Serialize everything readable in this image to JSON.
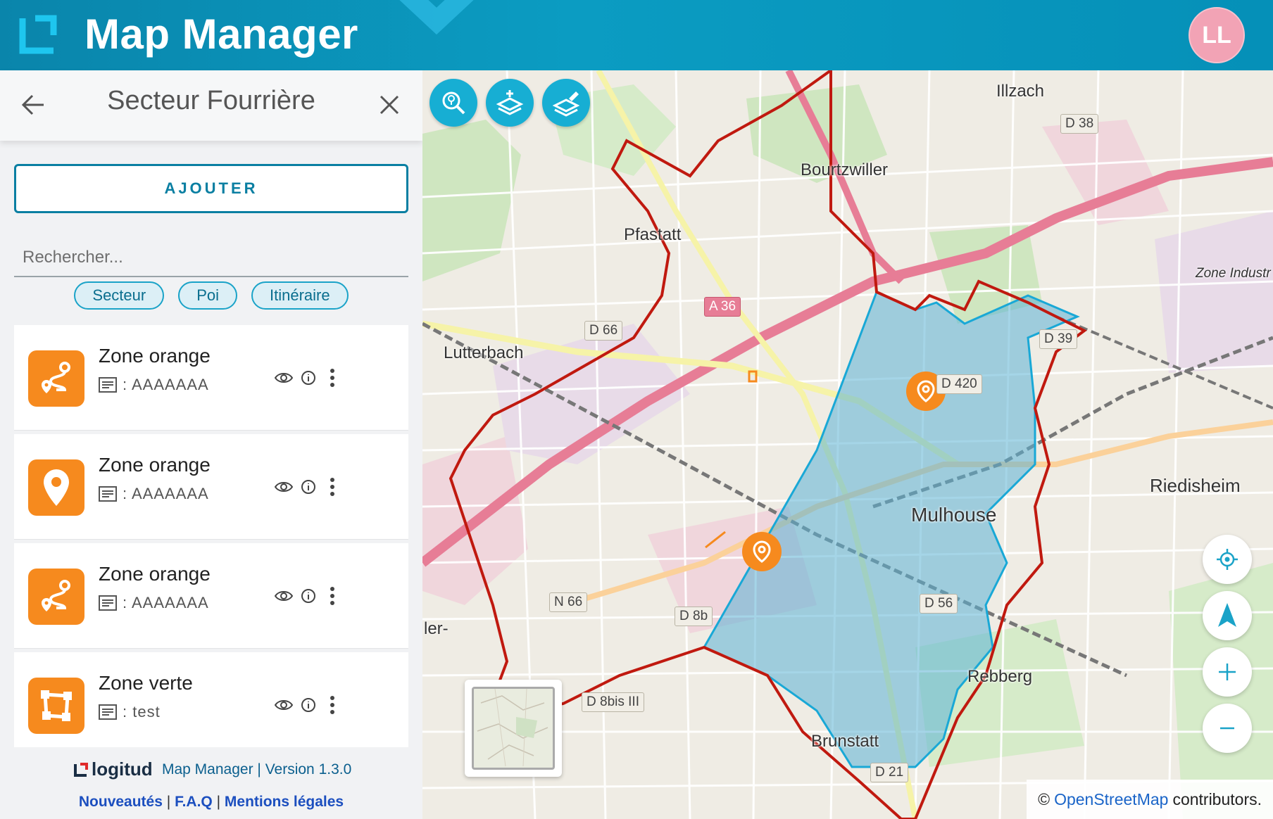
{
  "header": {
    "app_title": "Map Manager",
    "avatar_initials": "LL"
  },
  "sidebar": {
    "title": "Secteur Fourrière",
    "add_label": "AJOUTER",
    "search_placeholder": "Rechercher...",
    "chips": [
      "Secteur",
      "Poi",
      "Itinéraire"
    ],
    "items": [
      {
        "name": "Zone orange",
        "desc": ": AAAAAAA",
        "icon": "route-icon"
      },
      {
        "name": "Zone orange",
        "desc": ": AAAAAAA",
        "icon": "location-pin-icon"
      },
      {
        "name": "Zone orange",
        "desc": ": AAAAAAA",
        "icon": "route-icon"
      },
      {
        "name": "Zone verte",
        "desc": ": test",
        "icon": "polygon-icon"
      }
    ]
  },
  "footer": {
    "brand": "logitud",
    "version_text": "Map Manager | Version 1.3.0",
    "link_news": "Nouveautés",
    "link_faq": "F.A.Q",
    "link_legal": "Mentions légales",
    "sep": "|"
  },
  "map": {
    "places": {
      "illzach": "Illzach",
      "bourtzwiller": "Bourtzwiller",
      "pfastatt": "Pfastatt",
      "lutterbach": "Lutterbach",
      "mulhouse": "Mulhouse",
      "riedisheim": "Riedisheim",
      "rebberg": "Rebberg",
      "brunstatt": "Brunstatt",
      "zone_industrielle": "Zone Industr",
      "ler": "ler-"
    },
    "roads": {
      "d38": "D 38",
      "d66": "D 66",
      "a36": "A 36",
      "d39": "D 39",
      "d420": "D 420",
      "n66": "N 66",
      "d8b": "D 8b",
      "d8bis": "D 8bis III",
      "d56": "D 56",
      "d21": "D 21"
    },
    "attribution_prefix": "©",
    "attribution_link": "OpenStreetMap",
    "attribution_suffix": "contributors.",
    "colors": {
      "sector_outline": "#c0190f",
      "zone_fill": "#5bb3d6",
      "poi": "#f68a1e",
      "accent": "#17aed3"
    }
  }
}
